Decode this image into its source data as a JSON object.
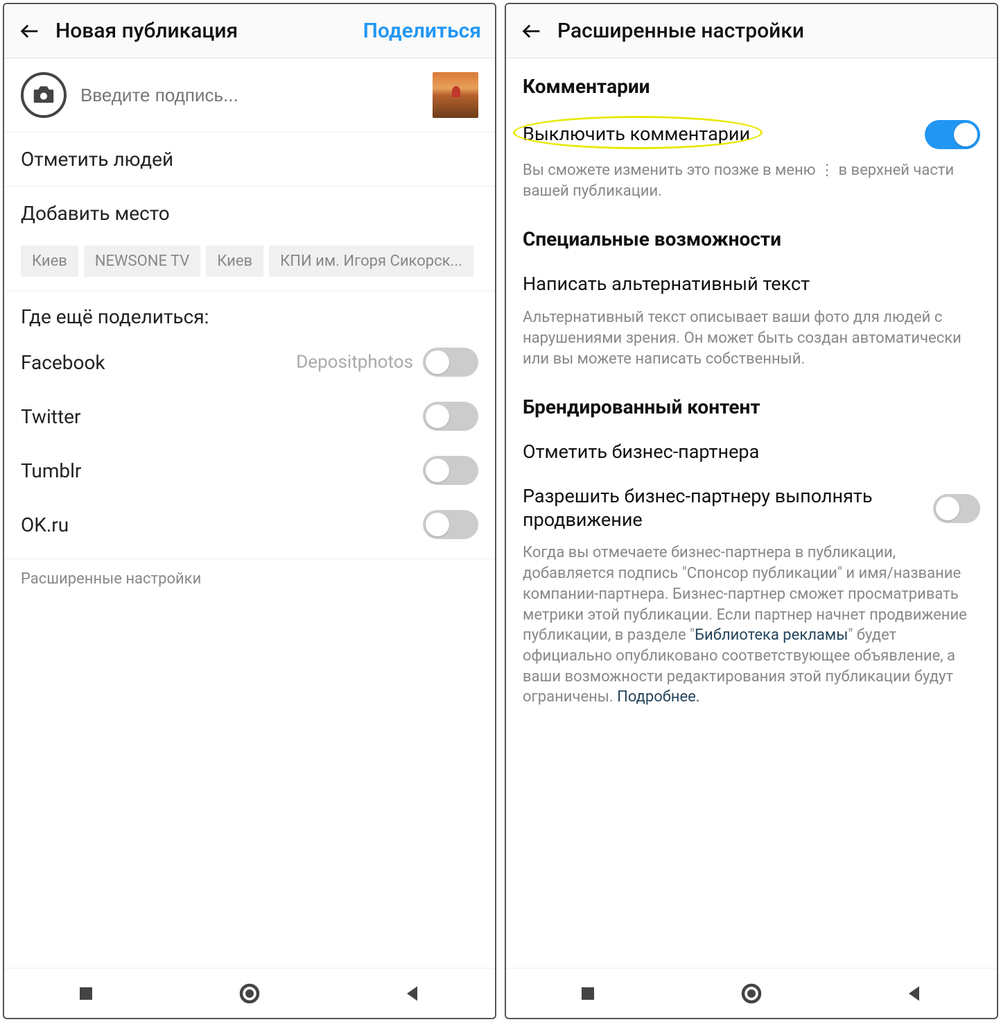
{
  "screen1": {
    "header": {
      "title": "Новая публикация",
      "action": "Поделиться"
    },
    "caption_placeholder": "Введите подпись...",
    "tag_people": "Отметить людей",
    "add_location": "Добавить место",
    "chips": [
      "Киев",
      "NEWSONE TV",
      "Киев",
      "КПИ им. Игоря Сикорск..."
    ],
    "share_title": "Где ещё поделиться:",
    "share_targets": [
      {
        "name": "Facebook",
        "hint": "Depositphotos",
        "on": false
      },
      {
        "name": "Twitter",
        "hint": "",
        "on": false
      },
      {
        "name": "Tumblr",
        "hint": "",
        "on": false
      },
      {
        "name": "OK.ru",
        "hint": "",
        "on": false
      }
    ],
    "advanced_link": "Расширенные настройки"
  },
  "screen2": {
    "header": {
      "title": "Расширенные настройки"
    },
    "comments_section": "Комментарии",
    "disable_comments": "Выключить комментарии",
    "disable_comments_on": true,
    "disable_comments_desc": "Вы сможете изменить это позже в меню ⋮ в верхней части вашей публикации.",
    "accessibility_section": "Специальные возможности",
    "alt_text": "Написать альтернативный текст",
    "alt_text_desc": "Альтернативный текст описывает ваши фото для людей с нарушениями зрения. Он может быть создан автоматически или вы можете написать собственный.",
    "branded_section": "Брендированный контент",
    "tag_partner": "Отметить бизнес-партнера",
    "allow_promo": "Разрешить бизнес-партнеру выполнять продвижение",
    "allow_promo_on": false,
    "branded_desc_1": "Когда вы отмечаете бизнес-партнера в публикации, добавляется подпись \"Спонсор публикации\" и имя/название компании-партнера. Бизнес-партнер сможет просматривать метрики этой публикации. Если партнер начнет продвижение публикации, в разделе \"",
    "branded_link_1": "Библиотека рекламы",
    "branded_desc_2": "\" будет официально опубликовано соответствующее объявление, а ваши возможности редактирования этой публикации будут ограничены. ",
    "branded_link_2": "Подробнее."
  }
}
